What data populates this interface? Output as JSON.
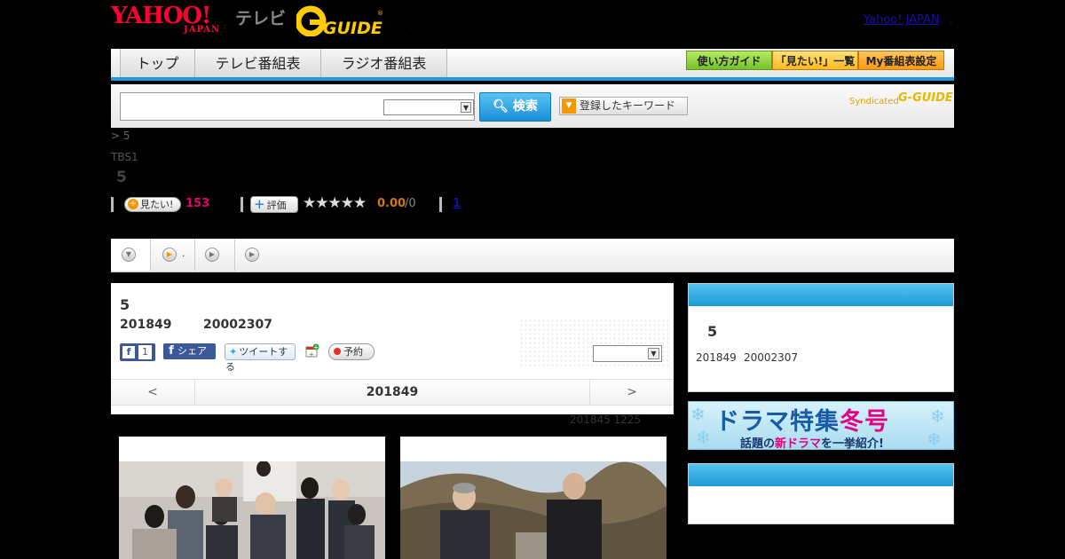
{
  "header": {
    "yahoo_logo": "YAHOO!",
    "yahoo_sub": "JAPAN",
    "tv_label": "テレビ",
    "gguide_logo": "G-GUIDE",
    "dot": ".",
    "yahoo_japan_link": "Yahoo! JAPAN",
    "yahoo_japan_dot": "."
  },
  "nav": {
    "tabs": [
      {
        "label": "トップ"
      },
      {
        "label": "テレビ番組表"
      },
      {
        "label": "ラジオ番組表"
      }
    ],
    "buttons": [
      {
        "label": "使い方ガイド",
        "color": "#8cd03c"
      },
      {
        "label": "「見たい!」一覧",
        "color": "#ffc233"
      },
      {
        "label": "My番組表設定",
        "color": "#ffa319"
      }
    ]
  },
  "search": {
    "input_value": "",
    "select_value": "",
    "search_button": "検索",
    "keyword_button": "登録したキーワード",
    "syndicated": "Syndicated",
    "syndicated_logo": "G-GUIDE"
  },
  "breadcrumb": "> 5",
  "channel": "TBS1",
  "program_title": "5",
  "stats": {
    "want_label": "見たい!",
    "want_count": "153",
    "rate_label": "評価",
    "stars": "★★★★★",
    "rating": "0.00",
    "rating_count": "/0",
    "review_link": "1"
  },
  "subtabs": {
    "tab2_dot": "."
  },
  "episode": {
    "number": "5",
    "air_date": "201849",
    "air_time": "20002307",
    "fb_like_count": "1",
    "fb_share_label": "シェア",
    "tweet_label": "ツイートする",
    "reserve_label": "予約",
    "select_value": "",
    "prev": "<",
    "nav_date": "201849",
    "next": ">",
    "update_note": "201845  1225"
  },
  "right": {
    "box1_number": "5",
    "box1_date": "201849",
    "box1_time": "20002307",
    "banner_title_a": "ドラマ特集",
    "banner_title_b": "冬号",
    "banner_sub_a": "話題の",
    "banner_sub_b": "新ドラマ",
    "banner_sub_c": "を一挙紹介!"
  },
  "colors": {
    "accent_blue": "#1e9ad6",
    "want_count": "#e4006b",
    "rating": "#d07a00",
    "link": "#1a0dab"
  }
}
